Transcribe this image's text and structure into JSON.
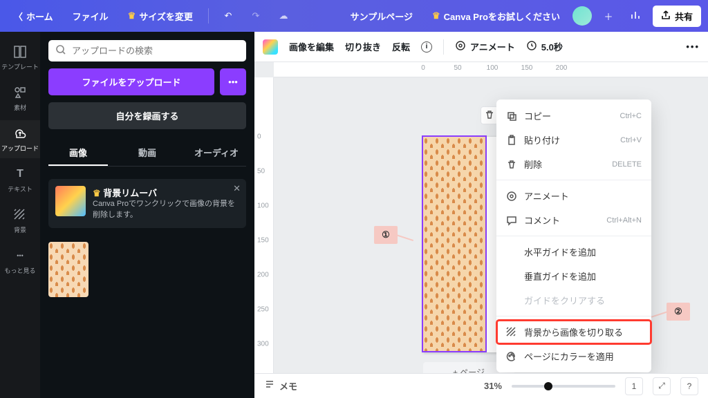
{
  "header": {
    "home": "ホーム",
    "file": "ファイル",
    "resize": "サイズを変更",
    "doc_title": "サンプルページ",
    "try_pro": "Canva Proをお試しください",
    "share": "共有"
  },
  "rail": {
    "templates": "テンプレート",
    "elements": "素材",
    "uploads": "アップロード",
    "text": "テキスト",
    "background": "背景",
    "more": "もっと見る"
  },
  "panel": {
    "search_placeholder": "アップロードの検索",
    "upload_btn": "ファイルをアップロード",
    "record_btn": "自分を録画する",
    "tabs": {
      "image": "画像",
      "video": "動画",
      "audio": "オーディオ"
    },
    "promo": {
      "title": "背景リムーバ",
      "desc": "Canva Proでワンクリックで画像の背景を削除します。"
    }
  },
  "toolbar": {
    "edit_image": "画像を編集",
    "crop": "切り抜き",
    "flip": "反転",
    "animate": "アニメート",
    "duration": "5.0秒"
  },
  "ruler_h": [
    "0",
    "50",
    "100",
    "150",
    "200"
  ],
  "ruler_v": [
    "0",
    "50",
    "100",
    "150",
    "200",
    "250",
    "300"
  ],
  "context_menu": {
    "copy": {
      "label": "コピー",
      "kb": "Ctrl+C"
    },
    "paste": {
      "label": "貼り付け",
      "kb": "Ctrl+V"
    },
    "delete": {
      "label": "削除",
      "kb": "DELETE"
    },
    "animate": {
      "label": "アニメート"
    },
    "comment": {
      "label": "コメント",
      "kb": "Ctrl+Alt+N"
    },
    "hguide": {
      "label": "水平ガイドを追加"
    },
    "vguide": {
      "label": "垂直ガイドを追加"
    },
    "clearguides": {
      "label": "ガイドをクリアする"
    },
    "detach": {
      "label": "背景から画像を切り取る"
    },
    "applycolor": {
      "label": "ページにカラーを適用"
    }
  },
  "annotations": {
    "one": "①",
    "two": "②"
  },
  "canvas": {
    "add_page": "+ ページ"
  },
  "bottombar": {
    "notes": "メモ",
    "zoom": "31%",
    "page_of": "1",
    "zoom_pct": 31
  },
  "colors": {
    "accent": "#8b3dff",
    "highlight": "#ff3b30"
  }
}
